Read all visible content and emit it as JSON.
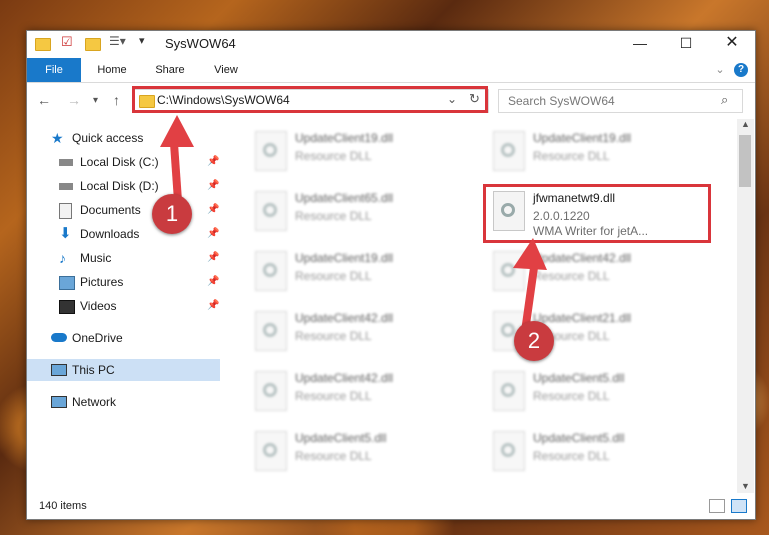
{
  "window": {
    "title": "SysWOW64"
  },
  "ribbon": {
    "tabs": [
      "File",
      "Home",
      "Share",
      "View"
    ]
  },
  "address": {
    "path": "C:\\Windows\\SysWOW64",
    "search_placeholder": "Search SysWOW64"
  },
  "sidebar": {
    "items": [
      {
        "label": "Quick access"
      },
      {
        "label": "Local Disk (C:)"
      },
      {
        "label": "Local Disk (D:)"
      },
      {
        "label": "Documents"
      },
      {
        "label": "Downloads"
      },
      {
        "label": "Music"
      },
      {
        "label": "Pictures"
      },
      {
        "label": "Videos"
      },
      {
        "label": "OneDrive"
      },
      {
        "label": "This PC"
      },
      {
        "label": "Network"
      }
    ]
  },
  "files": [
    {
      "name": "UpdateClient19.dll",
      "desc": "Resource DLL"
    },
    {
      "name": "UpdateClient19.dll",
      "desc": "Resource DLL"
    },
    {
      "name": "UpdateClient65.dll",
      "desc": "Resource DLL"
    },
    {
      "name": "jfwmanetwt9.dll",
      "desc": "2.0.0.1220",
      "desc2": "WMA Writer for jetA..."
    },
    {
      "name": "UpdateClient19.dll",
      "desc": "Resource DLL"
    },
    {
      "name": "UpdateClient42.dll",
      "desc": "Resource DLL"
    },
    {
      "name": "UpdateClient42.dll",
      "desc": "Resource DLL"
    },
    {
      "name": "UpdateClient21.dll",
      "desc": "Resource DLL"
    },
    {
      "name": "UpdateClient42.dll",
      "desc": "Resource DLL"
    },
    {
      "name": "UpdateClient5.dll",
      "desc": "Resource DLL"
    },
    {
      "name": "UpdateClient5.dll",
      "desc": "Resource DLL"
    },
    {
      "name": "UpdateClient5.dll",
      "desc": "Resource DLL"
    }
  ],
  "status": {
    "count": "140 items"
  },
  "annotations": {
    "step1": "1",
    "step2": "2"
  },
  "colors": {
    "accent": "#1979ca",
    "highlight": "#d9353b"
  }
}
